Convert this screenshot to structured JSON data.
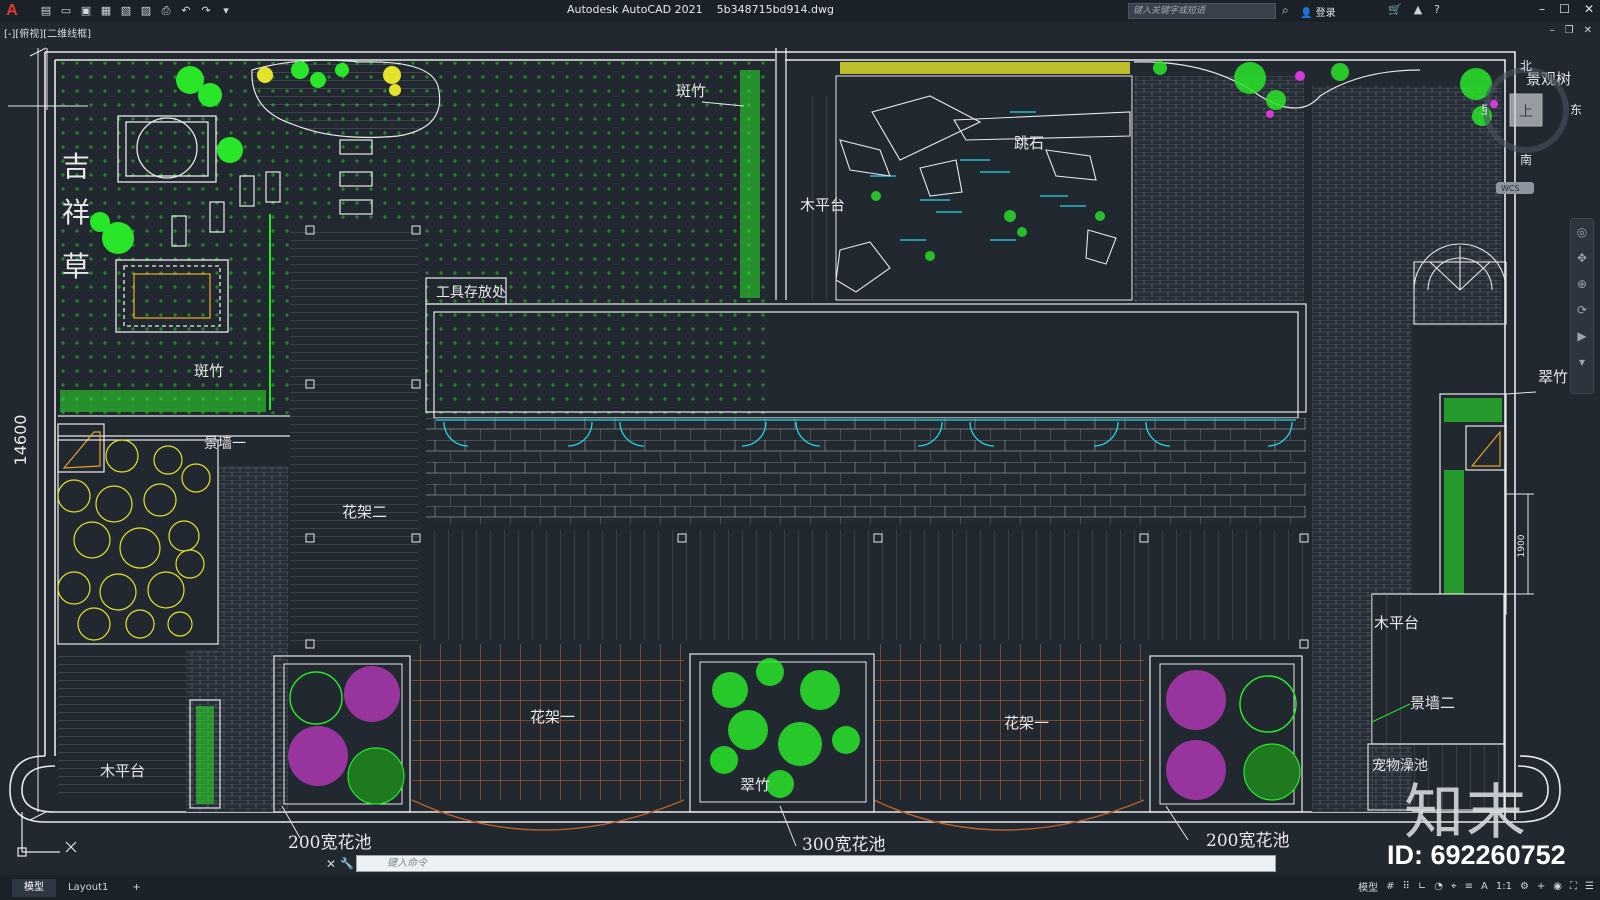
{
  "titlebar": {
    "app_name": "Autodesk AutoCAD 2021",
    "file_name": "5b348715bd914.dwg",
    "search_placeholder": "键入关键字或短语",
    "login_label": "登录"
  },
  "viewport": {
    "label": "[-][俯视][二维线框]"
  },
  "drawing": {
    "labels": {
      "jixiangcao_1": "吉",
      "jixiangcao_2": "祥",
      "jixiangcao_3": "草",
      "banzhu_top": "斑竹",
      "banzhu_left": "斑竹",
      "tiaoshi": "跳石",
      "mupingtai_top": "木平台",
      "tool_storage": "工具存放处",
      "jingqiang_1": "景墙一",
      "huajia_2": "花架二",
      "huajia_1_left": "花架一",
      "huajia_1_right": "花架一",
      "mupingtai_left": "木平台",
      "cuizhu_bottom": "翠竹",
      "cuizhu_right": "翠竹",
      "mupingtai_right": "木平台",
      "jingqiang_2": "景墙二",
      "pet_pool": "宠物澡池",
      "jingguanshu": "景观树",
      "pool_200_left": "200宽花池",
      "pool_300": "300宽花池",
      "pool_200_right": "200宽花池",
      "dim_14600": "14600",
      "dim_1900": "1900"
    }
  },
  "viewcube": {
    "north": "北",
    "south": "南",
    "east": "东",
    "west": "西",
    "top_face": "上",
    "wcs": "WCS"
  },
  "commandline": {
    "placeholder": "键入命令"
  },
  "tabs": [
    "模型",
    "Layout1",
    "+"
  ],
  "status": {
    "model_label": "模型",
    "scale": "1:1"
  },
  "watermark": {
    "brand": "知末",
    "id": "ID: 692260752"
  },
  "colors": {
    "background": "#212830",
    "line": "#e8e8e8",
    "plant_green": "#29e629",
    "plant_yellow": "#e3e32a",
    "plant_magenta": "#d83ad8",
    "wood_brown": "#b5602a",
    "water_cyan": "#2ad4e6"
  }
}
